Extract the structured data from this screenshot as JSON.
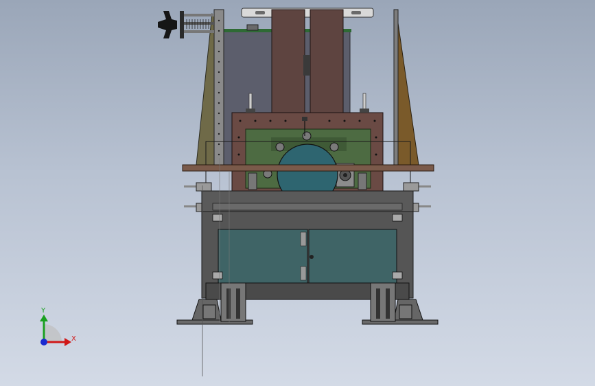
{
  "view": {
    "triad": {
      "x_label": "X",
      "y_label": "Y",
      "x_color": "#d01818",
      "y_color": "#1aa020",
      "z_color": "#1a2ad0"
    }
  },
  "colors": {
    "background_top": "#9aa6b8",
    "background_bottom": "#d3dae6",
    "frame": "#5a5a5a",
    "cabinet_door": "#3f6466",
    "brown_plate": "#6a4a44",
    "motor": "#2e6570",
    "olive_panel": "#4d6b42",
    "brace_left": "#6f6a48",
    "brace_right": "#7a5a2a"
  }
}
